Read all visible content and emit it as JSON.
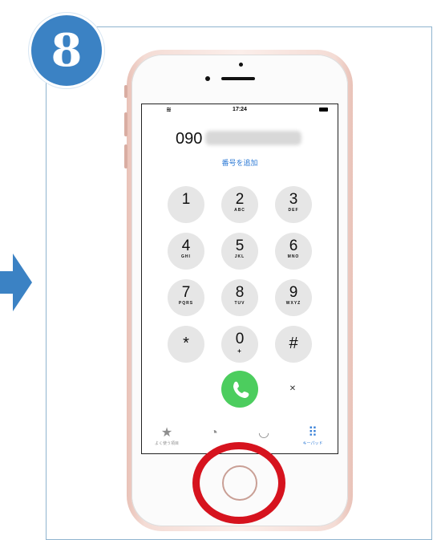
{
  "step": {
    "number": "8"
  },
  "status_bar": {
    "time": "17:24"
  },
  "dialer": {
    "number_prefix": "090",
    "add_number_label": "番号を追加",
    "keys": [
      {
        "digit": "1",
        "letters": ""
      },
      {
        "digit": "2",
        "letters": "ABC"
      },
      {
        "digit": "3",
        "letters": "DEF"
      },
      {
        "digit": "4",
        "letters": "GHI"
      },
      {
        "digit": "5",
        "letters": "JKL"
      },
      {
        "digit": "6",
        "letters": "MNO"
      },
      {
        "digit": "7",
        "letters": "PQRS"
      },
      {
        "digit": "8",
        "letters": "TUV"
      },
      {
        "digit": "9",
        "letters": "WXYZ"
      },
      {
        "digit": "*",
        "letters": ""
      },
      {
        "digit": "0",
        "letters": "+"
      },
      {
        "digit": "#",
        "letters": ""
      }
    ],
    "delete_symbol": "✕"
  },
  "tabs": [
    {
      "label": "よく使う項目",
      "icon": "star-icon",
      "glyph": "★"
    },
    {
      "label": "",
      "icon": "clock-icon",
      "glyph": "◔"
    },
    {
      "label": "",
      "icon": "contacts-icon",
      "glyph": "◡"
    },
    {
      "label": "キーパッド",
      "icon": "keypad-icon",
      "glyph": "⠿"
    }
  ],
  "colors": {
    "badge": "#3b82c4",
    "arrow": "#3b82c4",
    "call": "#4ccd5e",
    "highlight": "#d6131e",
    "link": "#2f7bd6"
  }
}
